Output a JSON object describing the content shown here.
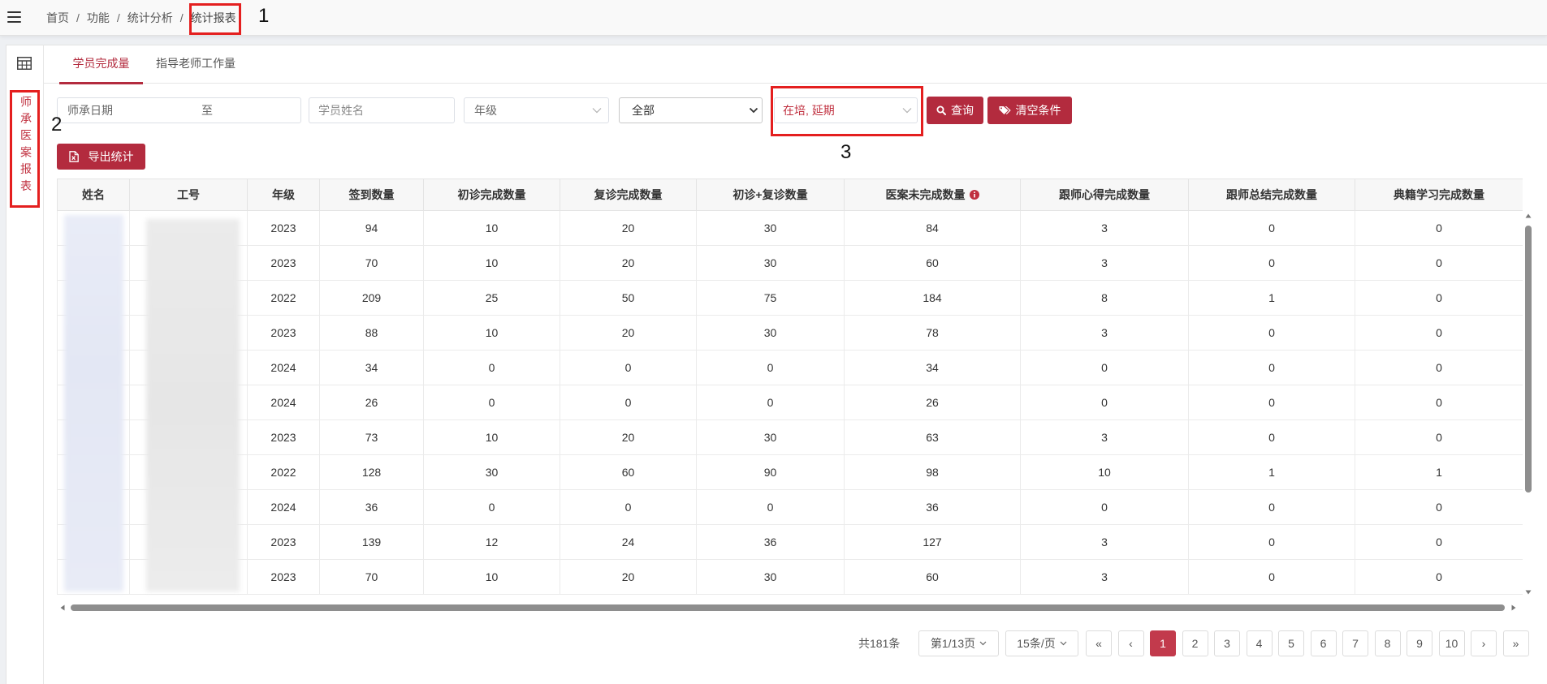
{
  "topbar": {
    "menu_icon": "hamburger-icon",
    "breadcrumb": [
      "首页",
      "功能",
      "统计分析",
      "统计报表"
    ],
    "separator": "/"
  },
  "sidebar": {
    "icon": "table-icon",
    "label": "师承医案报表"
  },
  "tabs": [
    {
      "label": "学员完成量",
      "active": true
    },
    {
      "label": "指导老师工作量",
      "active": false
    }
  ],
  "filters": {
    "date_range": {
      "start_placeholder": "师承日期",
      "separator": "至"
    },
    "student_name": {
      "placeholder": "学员姓名"
    },
    "grade": {
      "value": "年级",
      "icon": "chevron-down-icon"
    },
    "category": {
      "value": "全部",
      "icon": "caret-down-icon"
    },
    "status": {
      "value": "在培, 延期",
      "icon": "chevron-down-icon"
    },
    "search_button": {
      "label": "查询",
      "icon": "search-icon"
    },
    "clear_button": {
      "label": "清空条件",
      "icon": "tags-icon"
    }
  },
  "export_button": {
    "label": "导出统计",
    "icon": "file-export-icon"
  },
  "table": {
    "columns": [
      "姓名",
      "工号",
      "年级",
      "签到数量",
      "初诊完成数量",
      "复诊完成数量",
      "初诊+复诊数量",
      "医案未完成数量",
      "跟师心得完成数量",
      "跟师总结完成数量",
      "典籍学习完成数量"
    ],
    "header_info_icon": "info-icon",
    "rows": [
      [
        "2023",
        "94",
        "10",
        "20",
        "30",
        "84",
        "3",
        "0",
        "0"
      ],
      [
        "2023",
        "70",
        "10",
        "20",
        "30",
        "60",
        "3",
        "0",
        "0"
      ],
      [
        "2022",
        "209",
        "25",
        "50",
        "75",
        "184",
        "8",
        "1",
        "0"
      ],
      [
        "2023",
        "88",
        "10",
        "20",
        "30",
        "78",
        "3",
        "0",
        "0"
      ],
      [
        "2024",
        "34",
        "0",
        "0",
        "0",
        "34",
        "0",
        "0",
        "0"
      ],
      [
        "2024",
        "26",
        "0",
        "0",
        "0",
        "26",
        "0",
        "0",
        "0"
      ],
      [
        "2023",
        "73",
        "10",
        "20",
        "30",
        "63",
        "3",
        "0",
        "0"
      ],
      [
        "2022",
        "128",
        "30",
        "60",
        "90",
        "98",
        "10",
        "1",
        "1"
      ],
      [
        "2024",
        "36",
        "0",
        "0",
        "0",
        "36",
        "0",
        "0",
        "0"
      ],
      [
        "2023",
        "139",
        "12",
        "24",
        "36",
        "127",
        "3",
        "0",
        "0"
      ],
      [
        "2023",
        "70",
        "10",
        "20",
        "30",
        "60",
        "3",
        "0",
        "0"
      ]
    ]
  },
  "pagination": {
    "total": "共181条",
    "page_select": "第1/13页",
    "page_size": "15条/页",
    "first": "«",
    "prev": "‹",
    "pages": [
      "1",
      "2",
      "3",
      "4",
      "5",
      "6",
      "7",
      "8",
      "9",
      "10"
    ],
    "current": "1",
    "next": "›",
    "last": "»"
  },
  "annotations": {
    "marker_1": "1",
    "marker_2": "2",
    "marker_3": "3"
  },
  "colors": {
    "brand": "#b32b3e",
    "active_page": "#c23a4c",
    "annotation": "#e41f1f",
    "status_text": "#c0303f"
  }
}
